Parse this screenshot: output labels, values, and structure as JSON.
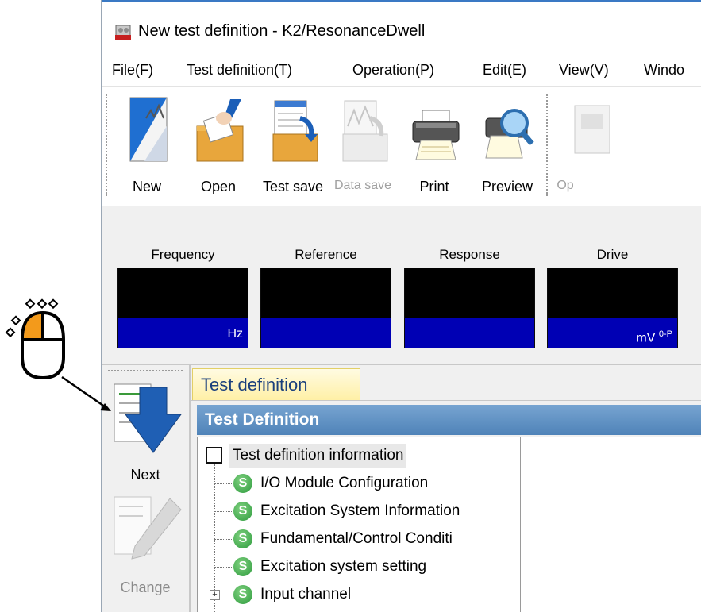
{
  "window": {
    "title": "New test definition - K2/ResonanceDwell"
  },
  "menu": [
    "File(F)",
    "Test definition(T)",
    "Operation(P)",
    "Edit(E)",
    "View(V)",
    "Windo"
  ],
  "toolbar": {
    "buttons": [
      {
        "label": "New",
        "icon": "new-document-icon",
        "enabled": true
      },
      {
        "label": "Open",
        "icon": "open-folder-icon",
        "enabled": true
      },
      {
        "label": "Test save",
        "icon": "test-save-icon",
        "enabled": true
      },
      {
        "label": "Data save",
        "icon": "data-save-icon",
        "enabled": false
      },
      {
        "label": "Print",
        "icon": "printer-icon",
        "enabled": true
      },
      {
        "label": "Preview",
        "icon": "preview-icon",
        "enabled": true
      },
      {
        "label": "Op",
        "icon": "operation-icon",
        "enabled": false
      }
    ]
  },
  "monitor": {
    "meters": [
      {
        "label": "Frequency",
        "unit": "Hz",
        "unit_sup": ""
      },
      {
        "label": "Reference",
        "unit": "",
        "unit_sup": ""
      },
      {
        "label": "Response",
        "unit": "",
        "unit_sup": ""
      },
      {
        "label": "Drive",
        "unit": "mV",
        "unit_sup": "0-P"
      }
    ],
    "colors": {
      "screen": "#000000",
      "unitbar": "#0000b4"
    }
  },
  "sidebar": {
    "buttons": [
      {
        "label": "Next",
        "icon": "next-arrow-icon",
        "enabled": true
      },
      {
        "label": "Change",
        "icon": "change-pencil-icon",
        "enabled": false
      }
    ]
  },
  "content": {
    "tab": "Test definition",
    "panel_title": "Test Definition",
    "tree": {
      "root": "Test definition information",
      "items": [
        "I/O Module Configuration",
        "Excitation System Information",
        "Fundamental/Control Conditi",
        "Excitation system setting",
        "Input channel"
      ],
      "badge": "S"
    }
  }
}
